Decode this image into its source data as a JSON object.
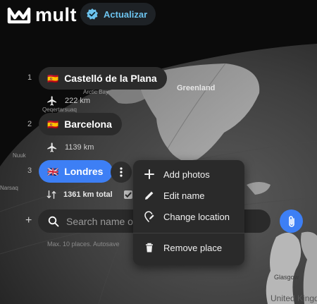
{
  "brand": {
    "name": "mult"
  },
  "upgrade": {
    "label": "Actualizar",
    "accent": "#6cc3ee"
  },
  "map": {
    "labels": {
      "greenland": "Greenland",
      "arctic_bay": "Arctic Bay",
      "qeqertarsuaq": "Qeqertarsuaq",
      "nuuk": "Nuuk",
      "narsaq": "Narsaq",
      "glasgow": "Glasgow",
      "united_kingdom": "United Kingdom"
    }
  },
  "itinerary": {
    "places": [
      {
        "index": "1",
        "flag": "🇪🇸",
        "name": "Castelló de la Plana"
      },
      {
        "index": "2",
        "flag": "🇪🇸",
        "name": "Barcelona"
      },
      {
        "index": "3",
        "flag": "🇬🇧",
        "name": "Londres"
      }
    ],
    "legs": [
      {
        "mode_icon": "airplane-icon",
        "distance": "222 km"
      },
      {
        "mode_icon": "airplane-icon",
        "distance": "1139 km"
      }
    ],
    "total": "1361 km total"
  },
  "search": {
    "placeholder": "Search name or address",
    "value": ""
  },
  "hint": "Max. 10 places. Autosave",
  "context_menu": {
    "items": [
      {
        "icon": "plus-icon",
        "label": "Add photos"
      },
      {
        "icon": "pencil-icon",
        "label": "Edit name"
      },
      {
        "icon": "location-edit-icon",
        "label": "Change location"
      },
      {
        "icon": "trash-icon",
        "label": "Remove place"
      }
    ]
  },
  "colors": {
    "accent_blue": "#3d7ff5",
    "pill_dark": "#2b2b2b",
    "menu_bg": "#2a2a2a"
  }
}
